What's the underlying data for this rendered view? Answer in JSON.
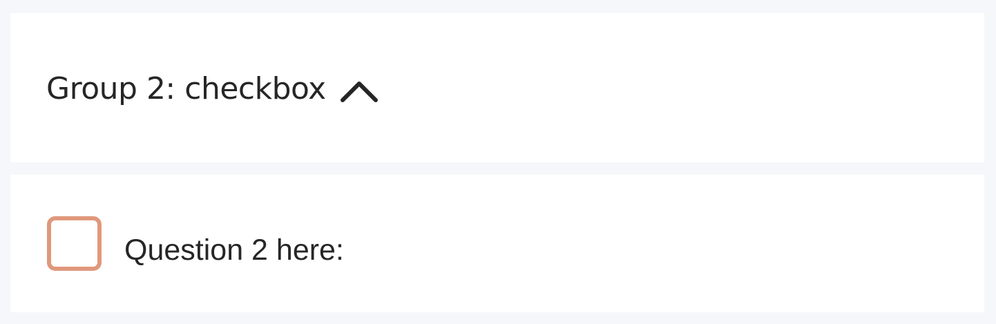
{
  "group": {
    "title": "Group 2: checkbox",
    "toggle_icon": "chevron-up-icon",
    "expanded": true
  },
  "question": {
    "label": "Question 2 here:",
    "checked": false
  },
  "colors": {
    "background": "#f6f7fa",
    "panel": "#ffffff",
    "text": "#262626",
    "checkbox_border": "#e0987c"
  }
}
